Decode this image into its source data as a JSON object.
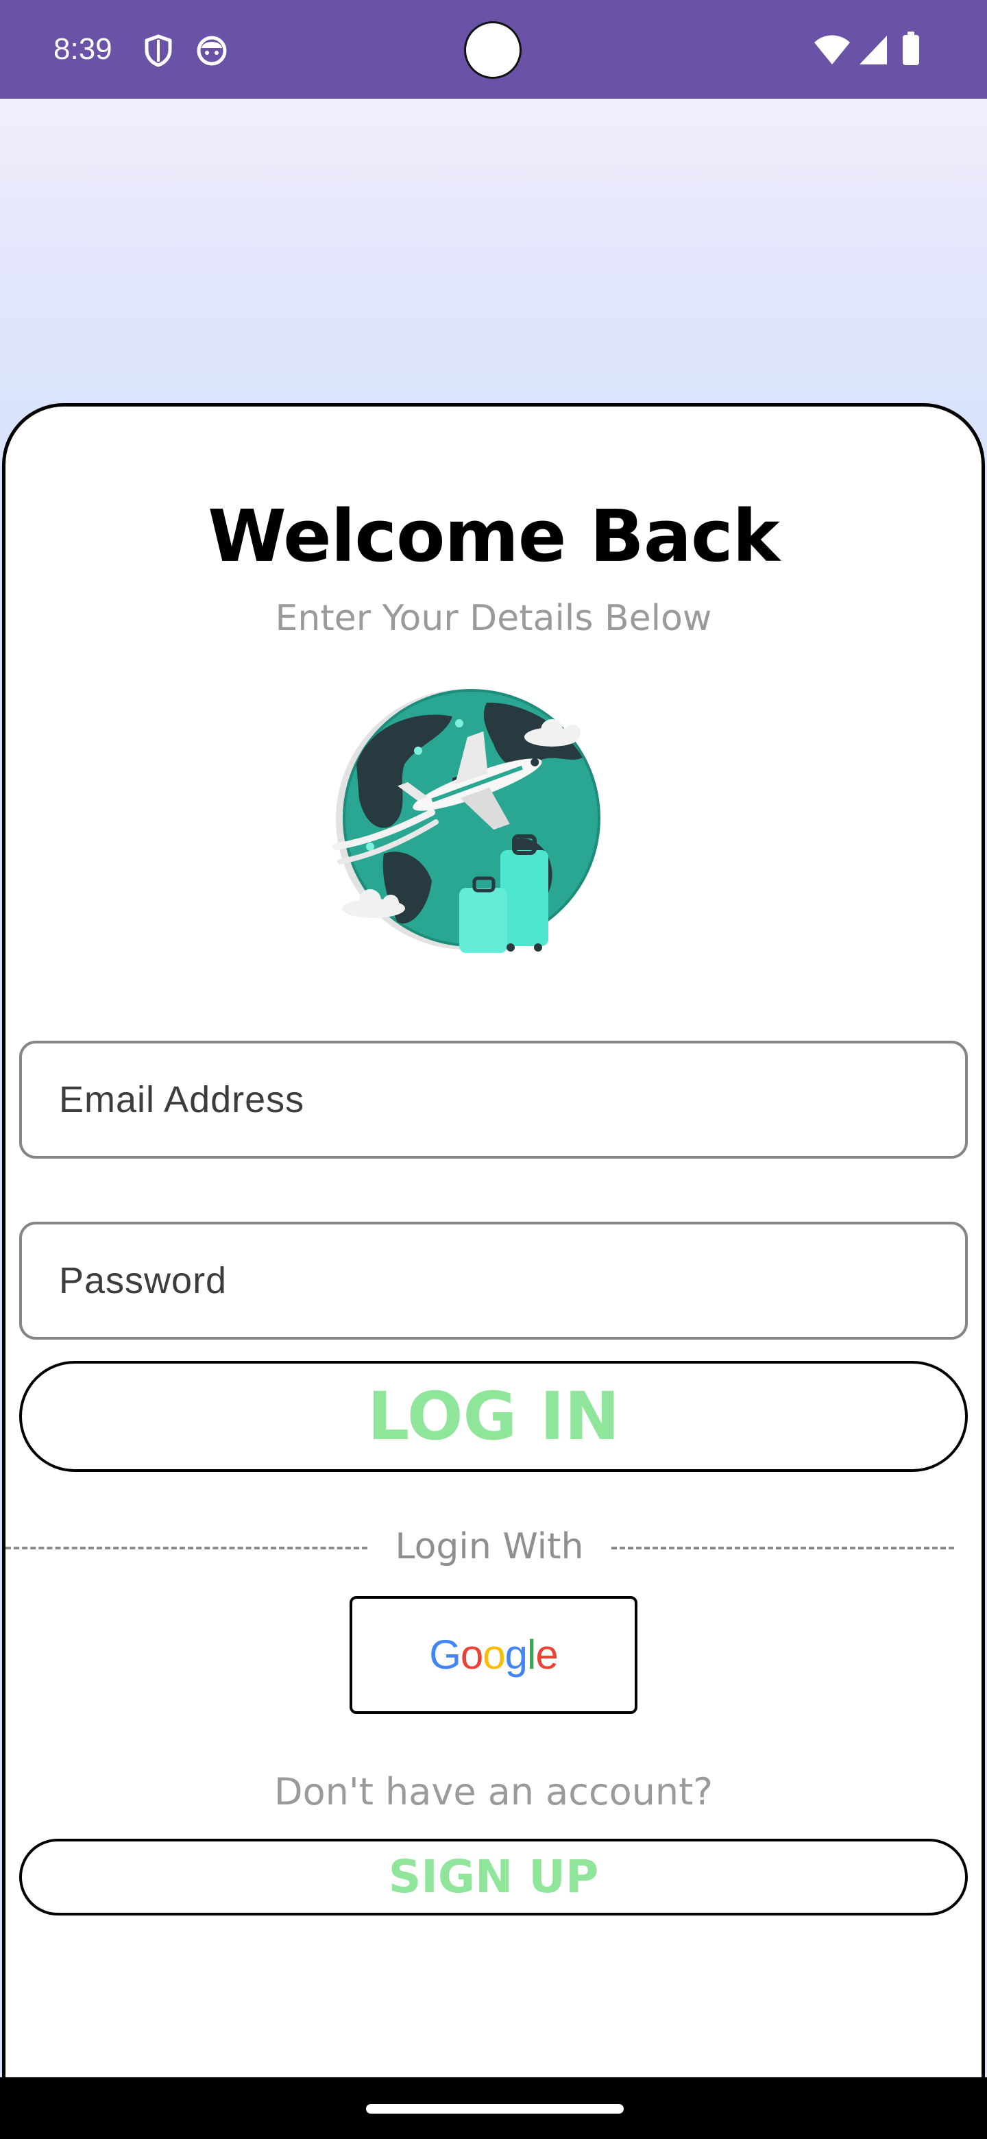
{
  "status_bar": {
    "time": "8:39",
    "left_icons": [
      "shield-icon",
      "face-icon"
    ],
    "right_icons": [
      "wifi-icon",
      "cell-signal-icon",
      "battery-icon"
    ],
    "background_color": "#6a52a6"
  },
  "header": {
    "title": "Welcome Back",
    "subtitle": "Enter Your Details Below"
  },
  "illustration": {
    "icon": "travel-globe-airplane-illustration"
  },
  "form": {
    "email_placeholder": "Email Address",
    "password_placeholder": "Password",
    "login_label": "LOG IN"
  },
  "divider": {
    "label": "Login With"
  },
  "social": {
    "google_letters": [
      "G",
      "o",
      "o",
      "g",
      "l",
      "e"
    ],
    "google_colors": [
      "#4285F4",
      "#EA4335",
      "#FBBC05",
      "#4285F4",
      "#34A853",
      "#EA4335"
    ]
  },
  "signup": {
    "prompt": "Don't have an account?",
    "label": "SIGN UP"
  },
  "colors": {
    "accent_green": "#8fe59a",
    "muted_text": "#9a9a9a"
  }
}
